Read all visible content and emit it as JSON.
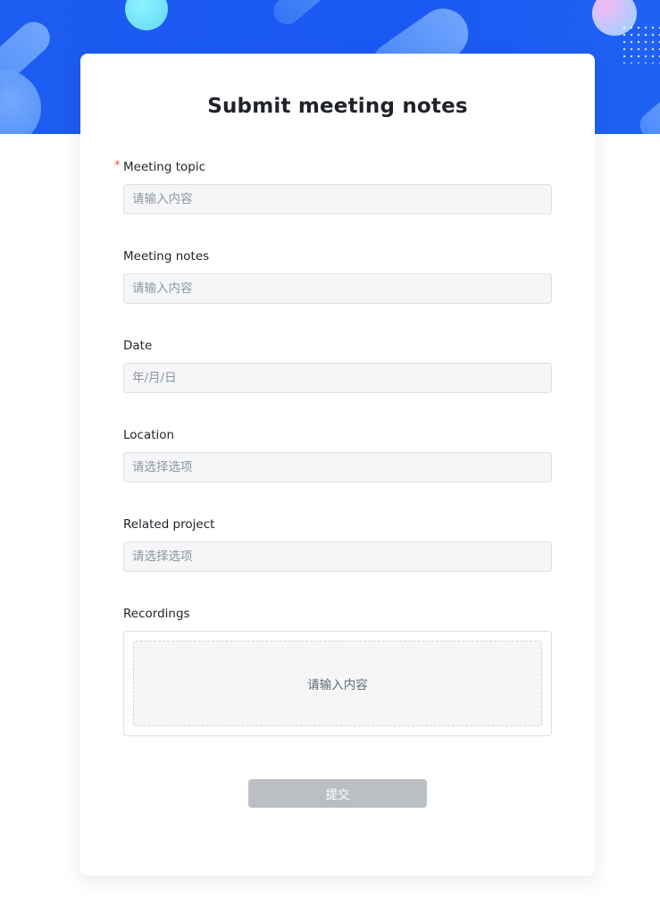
{
  "form": {
    "title": "Submit meeting notes",
    "required_mark": "*",
    "fields": {
      "topic": {
        "label": "Meeting topic",
        "placeholder": "请输入内容",
        "required": true
      },
      "notes": {
        "label": "Meeting notes",
        "placeholder": "请输入内容"
      },
      "date": {
        "label": "Date",
        "placeholder": "年/月/日"
      },
      "location": {
        "label": "Location",
        "placeholder": "请选择选项"
      },
      "project": {
        "label": "Related project",
        "placeholder": "请选择选项"
      },
      "recordings": {
        "label": "Recordings",
        "placeholder": "请输入内容"
      }
    },
    "submit_label": "提交"
  },
  "colors": {
    "header_blue": "#1d5cf0",
    "required_red": "#f54a45",
    "button_disabled": "#bbbfc4",
    "input_bg": "#f5f6f7"
  }
}
